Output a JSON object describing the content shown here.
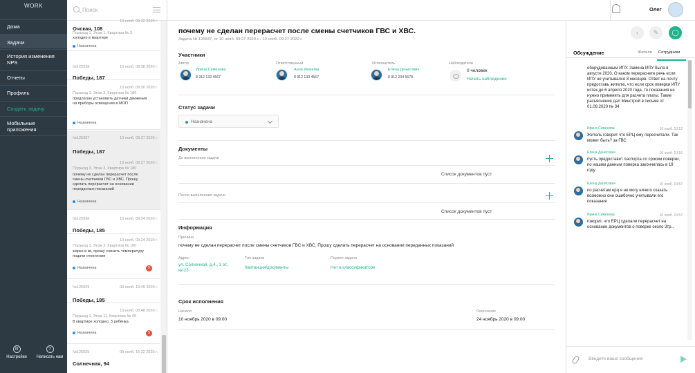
{
  "nav": {
    "brand": "WORK",
    "items": [
      "Дома",
      "Задачи",
      "История изменения NPS",
      "Отчеты",
      "Профиль"
    ],
    "create": "Создать задачу",
    "mobile": "Мобильные приложения",
    "settings": "Настройки",
    "write_us": "Написать нам"
  },
  "list": {
    "search_placeholder": "Поиск",
    "cards": [
      {
        "num": "",
        "date": "10 нояб. 09:32 2020 г.",
        "addr": "Очская, 108",
        "sub": "Подъезд 1, Этаж 1, Квартира № 3",
        "desc": "холодно в квартире",
        "status": "Назначена",
        "badge": ""
      },
      {
        "num": "№125938",
        "date": "10 нояб. 09:38 2020 г.",
        "addr": "Победы, 187",
        "sub": "",
        "desc": "",
        "status": "",
        "badge": ""
      },
      {
        "num": "",
        "date": "10 нояб. 09:30 2020 г.",
        "addr": "",
        "sub": "Подъезд 3, Этаж 3, Квартира № 180",
        "desc": "предлагаю установить датчики движения на приборы освещения в МОП",
        "status": "Назначена",
        "badge": ""
      },
      {
        "num": "№125937",
        "date": "10 нояб. 09:27 2020 г.",
        "addr": "Победы, 187",
        "sub": "",
        "desc": "",
        "status": "",
        "badge": ""
      },
      {
        "num": "",
        "date": "10 нояб. 09:27 2020 г.",
        "addr": "",
        "sub": "Подъезд 3, Этаж 3, Квартира № 180",
        "desc": "почему не сделан перерасчет после смены счетчиков ГВС и ХВС. Прошу сделать перерасчет на основании переданных показаний",
        "status": "Назначена",
        "badge": ""
      },
      {
        "num": "№125936",
        "date": "10 нояб. 09:24 2020 г.",
        "addr": "Победы, 185",
        "sub": "",
        "desc": "",
        "status": "",
        "badge": ""
      },
      {
        "num": "",
        "date": "10 нояб. 09:24 2020 г.",
        "addr": "",
        "sub": "Подъезд 3, Этаж 3, Квартира № 180",
        "desc": "жарко в кв, прошу снизить температуру подачи отопления",
        "status": "Назначена",
        "badge": "5"
      },
      {
        "num": "№125929",
        "date": "09 нояб. 19:49 2020 г.",
        "addr": "Победы, 185",
        "sub": "",
        "desc": "",
        "status": "",
        "badge": ""
      },
      {
        "num": "",
        "date": "10 нояб. 08:48 2020 г.",
        "addr": "",
        "sub": "Подъезд 1, Этаж 11, Квартира № 49",
        "desc": "В квартире холодно, 3 ребёнка",
        "status": "Назначена",
        "badge": "5"
      },
      {
        "num": "№125925",
        "date": "09 нояб. 16:32 2020 г.",
        "addr": "Солнечная, 94",
        "sub": "",
        "desc": "",
        "status": "",
        "badge": ""
      }
    ]
  },
  "topbar": {
    "user": "Олег"
  },
  "task": {
    "title": "почему не сделан перерасчет после смены счетчиков ГВС и ХВС.",
    "meta": "Задача № 125937, от 10 нояб. 09:27 2020 г. / 10 нояб. 09:27 2020 г.",
    "participants_title": "Участники",
    "author_label": "Автор",
    "author_name": "Ирина Семенова",
    "author_phone": "8 912 133 4567",
    "resp_label": "Ответственный",
    "resp_name": "Анна Иванова",
    "resp_phone": "8 912 133 4567",
    "exec_label": "Исполнитель",
    "exec_name": "Елена Денисович",
    "exec_phone": "8 912 234 5678",
    "observers_label": "Наблюдатели",
    "observers_count": "0 человек",
    "observers_link": "Начать наблюдение",
    "status_title": "Статус задачи",
    "status_value": "Назначена",
    "docs_title": "Документы",
    "docs_before": "До выполнения задачи",
    "docs_after": "После выполнения задачи",
    "docs_empty": "Список документов пуст",
    "info_title": "Информация",
    "reason_label": "Причина",
    "reason_text": "почему не сделан перерасчет после смены счетчиков ГВС и ХВС. Прошу сделать перерасчет на основании переданных показаний",
    "address_label": "Адрес",
    "address_value": "ул. Солнечная, д.4., 3 эт., кв.23",
    "type_label": "Тип задачи",
    "type_value": "Квитанция/документы",
    "subtype_label": "Подтип задачи",
    "subtype_value": "Нет в классификаторе",
    "deadline_title": "Срок исполнения",
    "start_label": "Начало",
    "start_value": "10 ноябрь 2020 в 09:00",
    "end_label": "Окончание",
    "end_value": "24 ноябрь 2020 в 09:00"
  },
  "discussion": {
    "title": "Обсуждение",
    "tab_residents": "Жители",
    "tab_staff": "Сотрудники",
    "first_text": "оборудованным ИПУ. Замена ИПУ была в августе 2020. О каком перерасчете речь если ИПУ не учитывался 8 месяцев. Ответ на почту предоставь жителю, что если срок поверки ИПУ истек до 6 апреля 2020 года, то показания не нужно применять для расчета платы. Такие разъяснения дал Минстрой в письме от 01.09.2020 № 34",
    "messages": [
      {
        "author": "Ирина Семенова",
        "time": "10 нояб. 10:12",
        "text": "Житель говорит что ЕРЦ ему пересчитали. Так может быть? за ГВС"
      },
      {
        "author": "Елена Денисович",
        "time": "10 нояб. 10:16",
        "text": "пусть предоставит паспорта со сроком поверки, по нашим данным поверка закончилась в 19 году."
      },
      {
        "author": "Елена Денисович",
        "time": "10 нояб. 10:57",
        "text": "по расчетам ерц я не могу ничего сказать возможно они ошибочно учитывали его показания"
      },
      {
        "author": "Ирина Семенова",
        "time": "10 нояб. 10:57",
        "text": "говорит, что ЕРЦ сделали перерасчет на основании документов о поверке около 3тр..."
      }
    ],
    "input_placeholder": "Введите ваше сообщение"
  }
}
